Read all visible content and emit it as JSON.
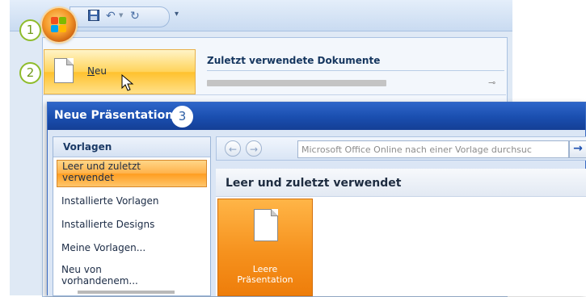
{
  "callouts": {
    "one": "1",
    "two": "2",
    "three": "3"
  },
  "office_menu": {
    "new_label_accel": "N",
    "new_label_rest": "eu",
    "recent_header": "Zuletzt verwendete Dokumente"
  },
  "dialog": {
    "title": "Neue Präsentation",
    "templates_header": "Vorlagen",
    "templates": [
      {
        "line1": "Leer und zuletzt",
        "line2": "verwendet"
      },
      {
        "line1": "Installierte Vorlagen"
      },
      {
        "line1": "Installierte Designs"
      },
      {
        "line1": "Meine Vorlagen..."
      },
      {
        "line1": "Neu von",
        "line2": "vorhandenem..."
      }
    ],
    "search_placeholder": "Microsoft Office Online nach einer Vorlage durchsuc",
    "section_title": "Leer und zuletzt verwendet",
    "blank_tile": {
      "line1": "Leere",
      "line2": "Präsentation"
    }
  },
  "colors": {
    "accent_blue": "#1a4eaf",
    "selection_orange": "#ffb24a",
    "callout_green": "#8fbc2b"
  },
  "icons": {
    "office_button": "office-logo",
    "save": "save-icon",
    "undo": "undo-icon",
    "redo": "redo-icon",
    "customize": "customize-qat-icon",
    "new_document": "blank-document-icon",
    "pin": "pin-icon",
    "back": "back-arrow-icon",
    "forward": "forward-arrow-icon",
    "go": "go-arrow-icon"
  }
}
